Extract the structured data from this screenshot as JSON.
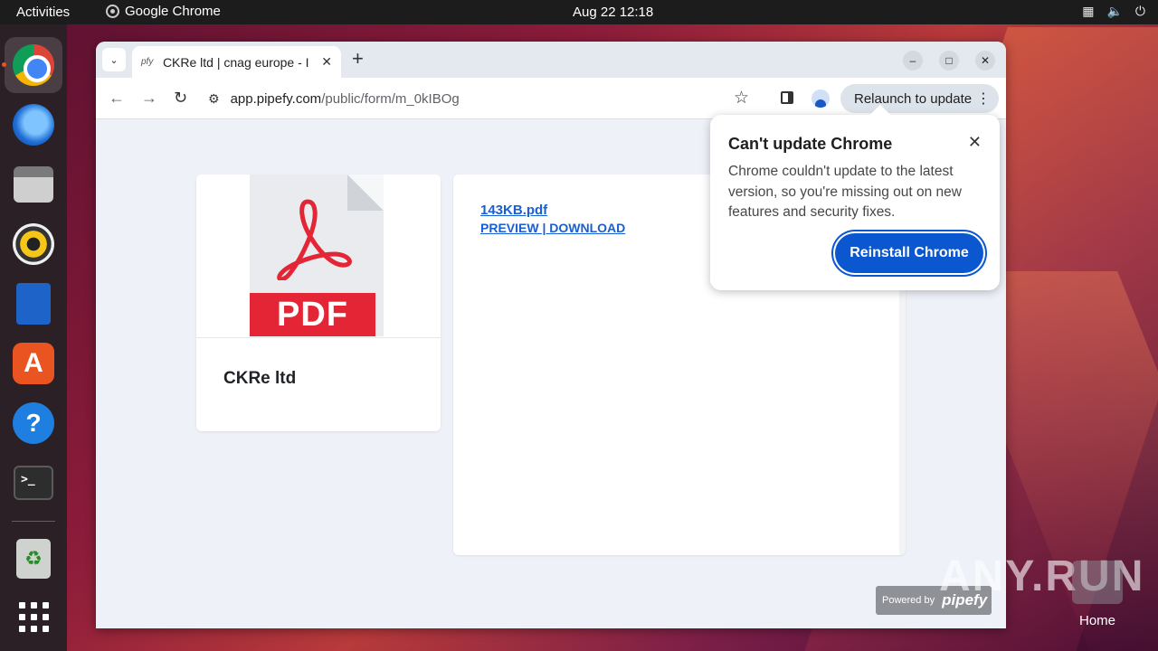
{
  "topbar": {
    "activities": "Activities",
    "app_name": "Google Chrome",
    "clock": "Aug 22  12:18",
    "status_icons": [
      "network-icon",
      "volume-icon",
      "power-icon"
    ]
  },
  "dock": {
    "items": [
      "chrome",
      "thunderbird",
      "files",
      "rhythmbox",
      "libreoffice-writer",
      "app-center",
      "help",
      "terminal",
      "trash",
      "show-apps"
    ],
    "terminal_prompt": ">_",
    "help_glyph": "?"
  },
  "browser": {
    "tab": {
      "favicon": "pfy",
      "title": "CKRe ltd | cnag europe - I"
    },
    "url": {
      "host": "app.pipefy.com",
      "path": "/public/form/m_0kIBOg"
    },
    "relaunch_label": "Relaunch to update"
  },
  "page": {
    "card_name": "CKRe ltd",
    "pdf_badge": "PDF",
    "file_name": "143KB.pdf",
    "file_actions": "PREVIEW | DOWNLOAD",
    "powered_by": "Powered by",
    "brand": "pipefy"
  },
  "bubble": {
    "title": "Can't update Chrome",
    "body": "Chrome couldn't update to the latest version, so you're missing out on new features and security fixes.",
    "button": "Reinstall Chrome"
  },
  "desktop": {
    "watermark": "ANY.RUN",
    "home_label": "Home"
  },
  "colors": {
    "accent": "#0b57d0",
    "link": "#1a5fd1",
    "pdf_red": "#e42535",
    "ubuntu_orange": "#e95420"
  }
}
